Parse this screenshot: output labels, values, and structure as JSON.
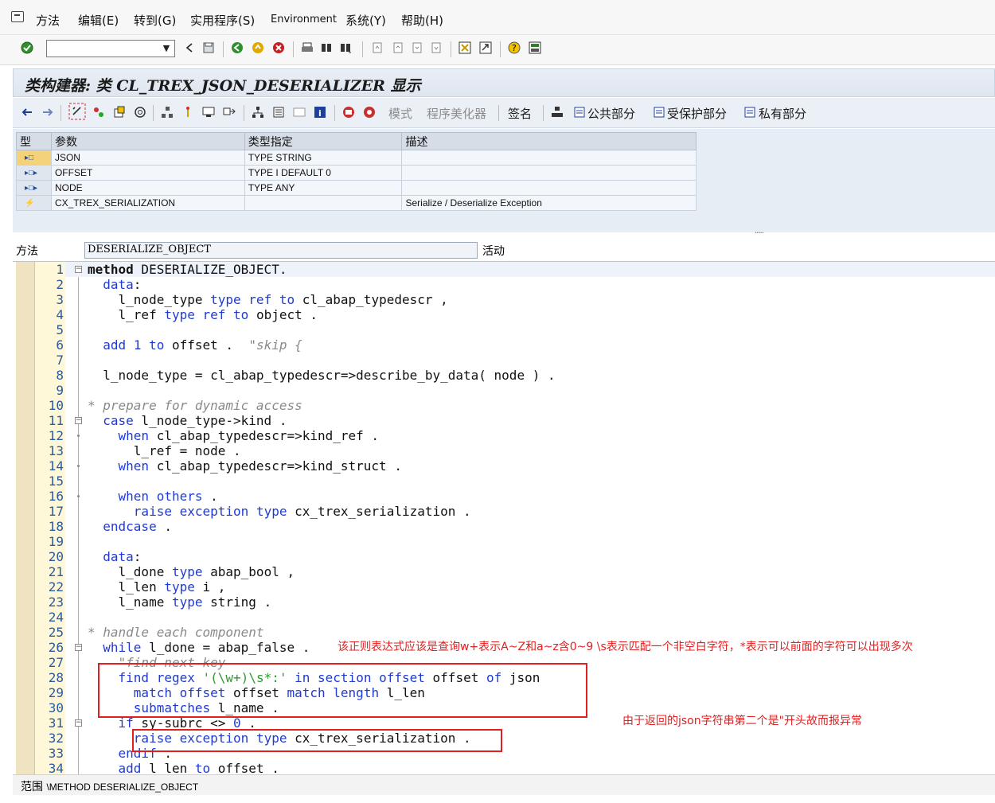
{
  "menubar": {
    "items": [
      "方法",
      "编辑(E)",
      "转到(G)",
      "实用程序(S)",
      "Environment",
      "系统(Y)",
      "帮助(H)"
    ]
  },
  "toolbar": {
    "command_field_value": "",
    "icons": [
      "enter-check-icon",
      "back-icon",
      "save-icon",
      "green-back-icon",
      "exit-icon",
      "cancel-icon",
      "print-icon",
      "find-icon",
      "find-next-icon",
      "first-page-icon",
      "prev-page-icon",
      "next-page-icon",
      "last-page-icon",
      "new-session-icon",
      "shortcut-icon",
      "help-icon",
      "layout-icon"
    ]
  },
  "title": "类构建器: 类 CL_TREX_JSON_DESERIALIZER 显示",
  "app_toolbar": {
    "labels": {
      "mode": "模式",
      "pretty_printer": "程序美化器",
      "signature": "签名",
      "public": "公共部分",
      "protected": "受保护部分",
      "private": "私有部分"
    }
  },
  "params_table": {
    "headers": [
      "型",
      "参数",
      "类型指定",
      "描述"
    ],
    "rows": [
      {
        "icon": "import-param-icon",
        "param": "JSON",
        "type": "TYPE STRING",
        "desc": ""
      },
      {
        "icon": "import-param-icon",
        "param": "OFFSET",
        "type": "TYPE I  DEFAULT 0",
        "desc": ""
      },
      {
        "icon": "import-param-icon",
        "param": "NODE",
        "type": "TYPE ANY",
        "desc": ""
      },
      {
        "icon": "exception-icon",
        "param": "CX_TREX_SERIALIZATION",
        "type": "",
        "desc": "Serialize / Deserialize Exception"
      }
    ]
  },
  "method_row": {
    "label": "方法",
    "value": "DESERIALIZE_OBJECT",
    "status": "活动"
  },
  "code_lines": [
    {
      "n": "1",
      "text": "method DESERIALIZE_OBJECT."
    },
    {
      "n": "2",
      "text": "  data:"
    },
    {
      "n": "3",
      "text": "    l_node_type type ref to cl_abap_typedescr ,"
    },
    {
      "n": "4",
      "text": "    l_ref type ref to object ."
    },
    {
      "n": "5",
      "text": ""
    },
    {
      "n": "6",
      "text": "  add 1 to offset .  \"skip {"
    },
    {
      "n": "7",
      "text": ""
    },
    {
      "n": "8",
      "text": "  l_node_type = cl_abap_typedescr=>describe_by_data( node ) ."
    },
    {
      "n": "9",
      "text": ""
    },
    {
      "n": "10",
      "text": "* prepare for dynamic access"
    },
    {
      "n": "11",
      "text": "  case l_node_type->kind ."
    },
    {
      "n": "12",
      "text": "    when cl_abap_typedescr=>kind_ref ."
    },
    {
      "n": "13",
      "text": "      l_ref = node ."
    },
    {
      "n": "14",
      "text": "    when cl_abap_typedescr=>kind_struct ."
    },
    {
      "n": "15",
      "text": ""
    },
    {
      "n": "16",
      "text": "    when others ."
    },
    {
      "n": "17",
      "text": "      raise exception type cx_trex_serialization ."
    },
    {
      "n": "18",
      "text": "  endcase ."
    },
    {
      "n": "19",
      "text": ""
    },
    {
      "n": "20",
      "text": "  data:"
    },
    {
      "n": "21",
      "text": "    l_done type abap_bool ,"
    },
    {
      "n": "22",
      "text": "    l_len type i ,"
    },
    {
      "n": "23",
      "text": "    l_name type string ."
    },
    {
      "n": "24",
      "text": ""
    },
    {
      "n": "25",
      "text": "* handle each component"
    },
    {
      "n": "26",
      "text": "  while l_done = abap_false ."
    },
    {
      "n": "27",
      "text": "    \"find next key"
    },
    {
      "n": "28",
      "text": "    find regex '(\\w+)\\s*:' in section offset offset of json"
    },
    {
      "n": "29",
      "text": "      match offset offset match length l_len"
    },
    {
      "n": "30",
      "text": "      submatches l_name ."
    },
    {
      "n": "31",
      "text": "    if sy-subrc <> 0 ."
    },
    {
      "n": "32",
      "text": "      raise exception type cx_trex_serialization ."
    },
    {
      "n": "33",
      "text": "    endif ."
    },
    {
      "n": "34",
      "text": "    add l_len to offset ."
    }
  ],
  "annotations": {
    "regex_note": "该正则表达式应该是查询w+表示A~Z和a~z含0~9 \\s表示匹配一个非空白字符，*表示可以前面的字符可以出现多次",
    "exception_note": "由于返回的json字符串第二个是\"开头故而报异常"
  },
  "status_bar": {
    "label": "范围",
    "scope": "\\METHOD DESERIALIZE_OBJECT"
  },
  "colors": {
    "keyword": "#1f3bd1",
    "comment": "#8a8a8a",
    "string": "#2f9a2f",
    "annotation": "#e02020"
  }
}
